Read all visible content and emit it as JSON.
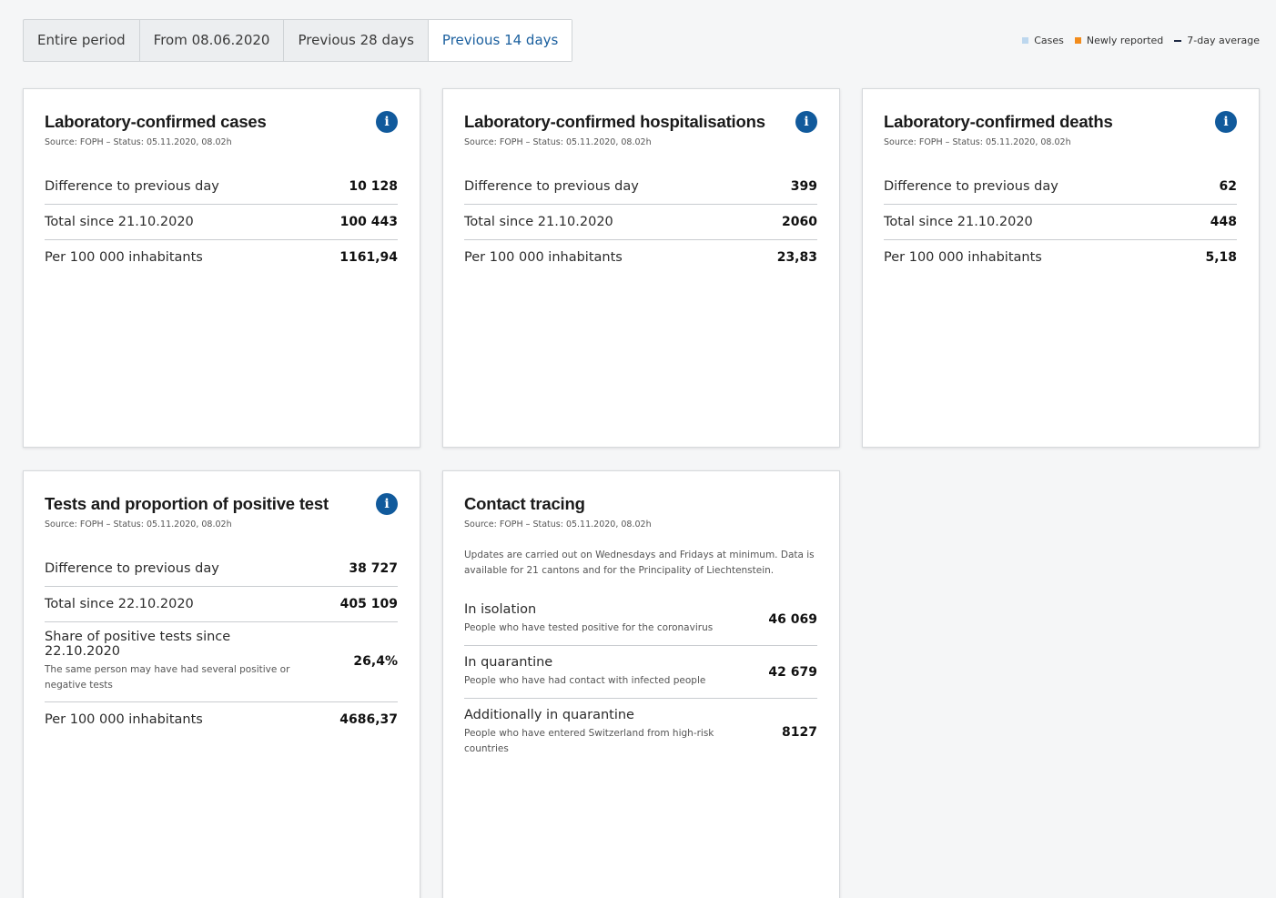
{
  "tabs": [
    {
      "label": "Entire period"
    },
    {
      "label": "From 08.06.2020"
    },
    {
      "label": "Previous 28 days"
    },
    {
      "label": "Previous 14 days"
    }
  ],
  "legend": [
    {
      "label": "Cases",
      "color": "#bdd7ee"
    },
    {
      "label": "Newly reported",
      "color": "#f28c1c"
    },
    {
      "label": "7-day average",
      "color": "#1f2a44"
    }
  ],
  "cards": {
    "cases": {
      "title": "Laboratory-confirmed cases",
      "source": "Source: FOPH – Status: 05.11.2020, 08.02h",
      "rows": [
        {
          "label": "Difference to previous day",
          "value": "10 128"
        },
        {
          "label": "Total since 21.10.2020",
          "value": "100 443"
        },
        {
          "label": "Per 100 000 inhabitants",
          "value": "1161,94"
        }
      ]
    },
    "hosp": {
      "title": "Laboratory-confirmed hospitalisations",
      "source": "Source: FOPH – Status: 05.11.2020, 08.02h",
      "rows": [
        {
          "label": "Difference to previous day",
          "value": "399"
        },
        {
          "label": "Total since 21.10.2020",
          "value": "2060"
        },
        {
          "label": "Per 100 000 inhabitants",
          "value": "23,83"
        }
      ]
    },
    "deaths": {
      "title": "Laboratory-confirmed deaths",
      "source": "Source: FOPH – Status: 05.11.2020, 08.02h",
      "rows": [
        {
          "label": "Difference to previous day",
          "value": "62"
        },
        {
          "label": "Total since 21.10.2020",
          "value": "448"
        },
        {
          "label": "Per 100 000 inhabitants",
          "value": "5,18"
        }
      ]
    },
    "tests": {
      "title": "Tests and proportion of positive test",
      "source": "Source: FOPH – Status: 05.11.2020, 08.02h",
      "rows": [
        {
          "label": "Difference to previous day",
          "value": "38 727"
        },
        {
          "label": "Total since 22.10.2020",
          "value": "405 109"
        },
        {
          "label": "Share of positive tests since 22.10.2020",
          "sublabel": "The same person may have had several positive or negative tests",
          "value": "26,4%"
        },
        {
          "label": "Per 100 000 inhabitants",
          "value": "4686,37"
        }
      ]
    },
    "contact": {
      "title": "Contact tracing",
      "source": "Source: FOPH – Status: 05.11.2020, 08.02h",
      "note": "Updates are carried out on Wednesdays and Fridays at minimum. Data is available for 21 cantons and for the Principality of Liechtenstein.",
      "rows": [
        {
          "label": "In isolation",
          "sublabel": "People who have tested positive for the coronavirus",
          "value": "46 069"
        },
        {
          "label": "In quarantine",
          "sublabel": "People who have had contact with infected people",
          "value": "42 679"
        },
        {
          "label": "Additionally in quarantine",
          "sublabel": "People who have entered Switzerland from high-risk countries",
          "value": "8127"
        }
      ]
    }
  }
}
